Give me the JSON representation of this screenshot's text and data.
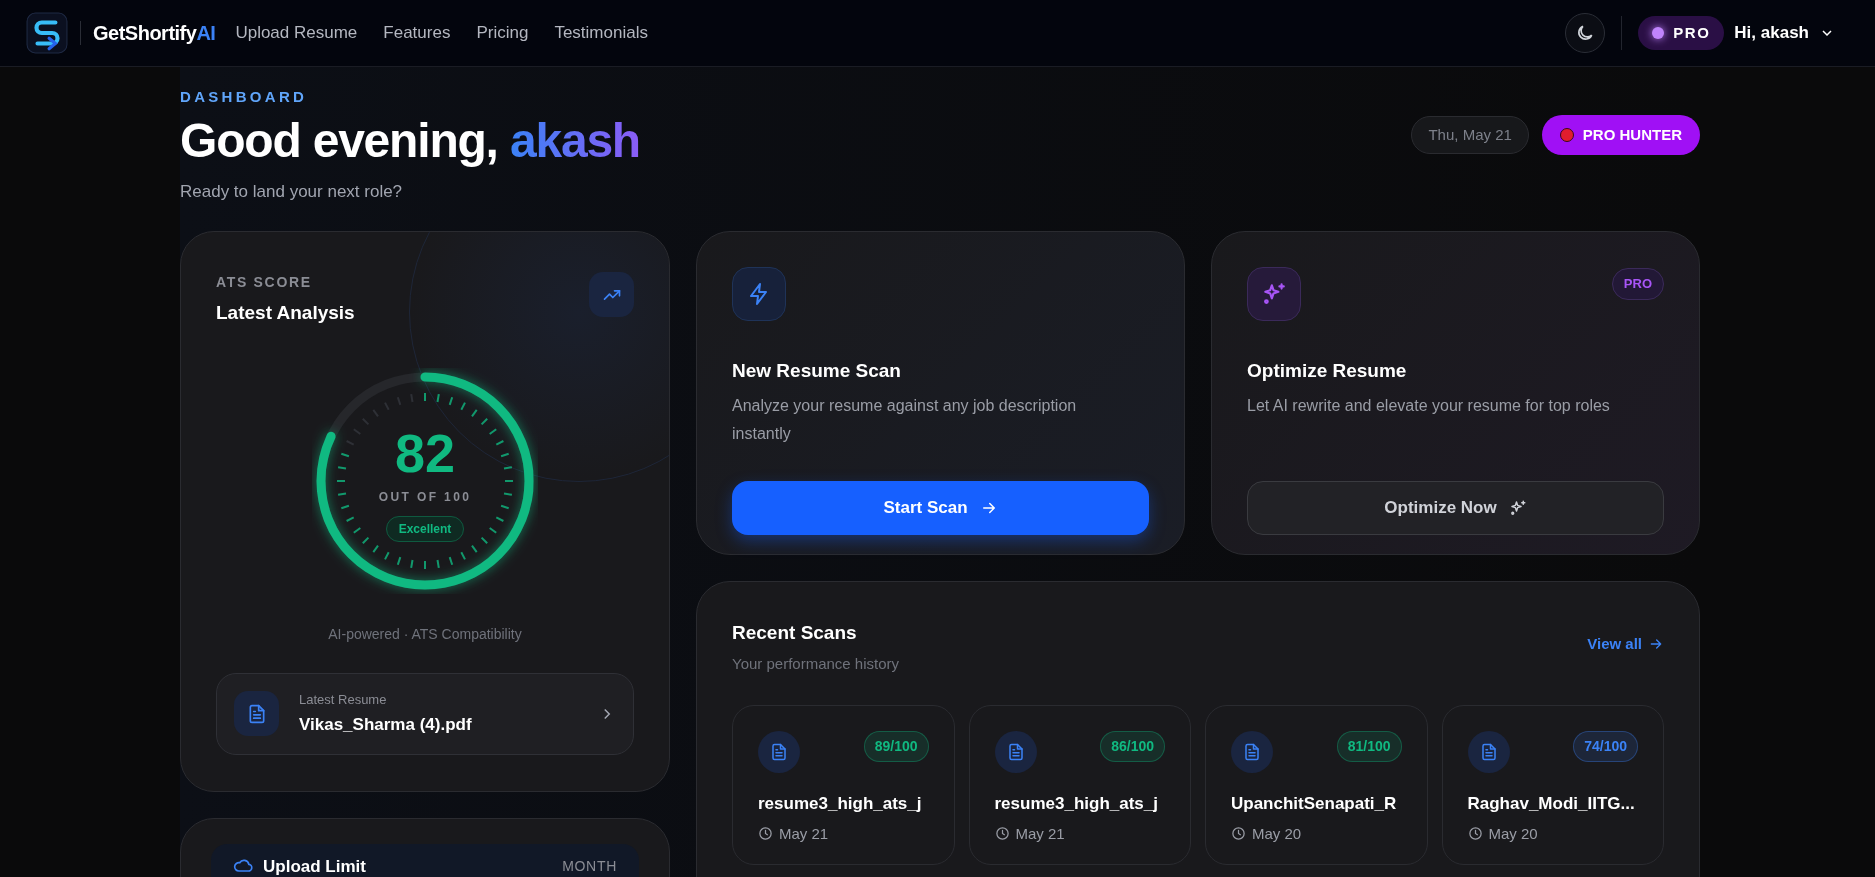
{
  "nav": {
    "brand_main": "GetShortify",
    "brand_accent": "AI",
    "links": [
      "Upload Resume",
      "Features",
      "Pricing",
      "Testimonials"
    ],
    "plan_badge": "PRO",
    "greeting": "Hi, akash"
  },
  "header": {
    "eyebrow": "DASHBOARD",
    "greeting": "Good evening,",
    "name": "akash",
    "subtitle": "Ready to land your next role?",
    "date": "Thu, May 21",
    "rank_badge": "PRO HUNTER"
  },
  "ats_card": {
    "eyebrow": "ATS SCORE",
    "title": "Latest Analysis",
    "score": "82",
    "score_caption": "OUT OF 100",
    "rating": "Excellent",
    "level": 0.82,
    "footnote": "AI-powered · ATS Compatibility",
    "latest_label": "Latest Resume",
    "latest_file": "Vikas_Sharma (4).pdf"
  },
  "actions": [
    {
      "kind": "scan",
      "title": "New Resume Scan",
      "description": "Analyze your resume against any job description instantly",
      "button": "Start Scan"
    },
    {
      "kind": "optimize",
      "badge": "PRO",
      "title": "Optimize Resume",
      "description": "Let AI rewrite and elevate your resume for top roles",
      "button": "Optimize Now"
    }
  ],
  "recent_scans": {
    "title": "Recent Scans",
    "subtitle": "Your performance history",
    "view_all": "View all",
    "items": [
      {
        "score": "89/100",
        "color": "#10b981",
        "name": "resume3_high_ats_j",
        "date": "May 21"
      },
      {
        "score": "86/100",
        "color": "#10b981",
        "name": "resume3_high_ats_j",
        "date": "May 21"
      },
      {
        "score": "81/100",
        "color": "#10b981",
        "name": "UpanchitSenapati_R",
        "date": "May 20"
      },
      {
        "score": "74/100",
        "color": "#3b82f6",
        "name": "Raghav_Modi_IITG...",
        "date": "May 20"
      }
    ]
  },
  "upload_card": {
    "title": "Upload Limit",
    "period": "MONTH"
  }
}
